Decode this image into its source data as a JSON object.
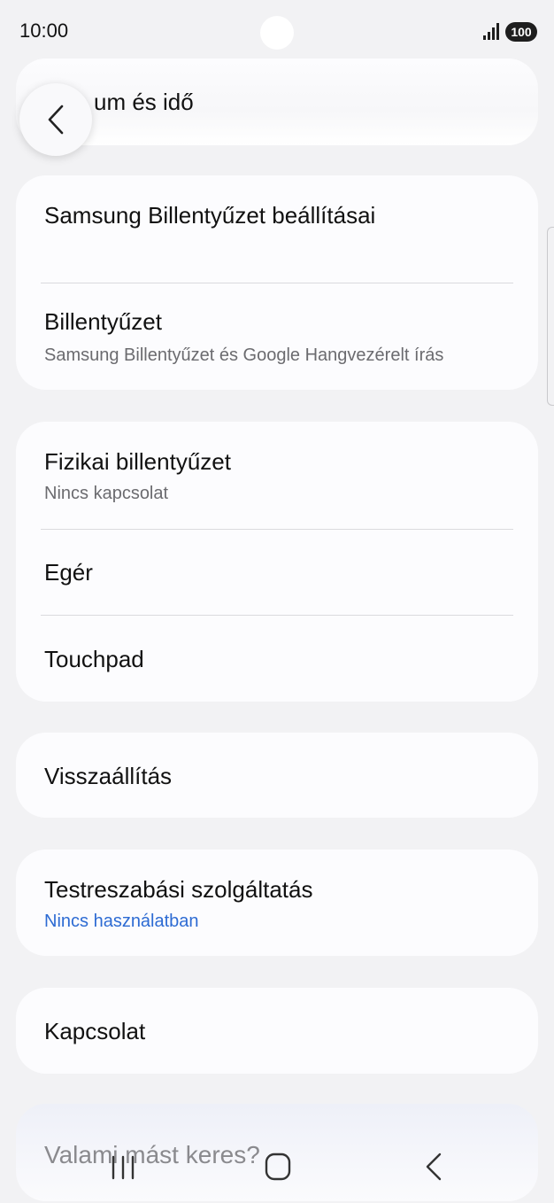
{
  "status_bar": {
    "time": "10:00",
    "battery": "100"
  },
  "header": {
    "partial_title": "um és idő"
  },
  "group1": {
    "samsung_keyboard": {
      "title": "Samsung Billentyűzet beállításai"
    },
    "keyboard": {
      "title": "Billentyűzet",
      "subtitle": "Samsung Billentyűzet és Google Hangvezérelt írás"
    }
  },
  "group2": {
    "physical_keyboard": {
      "title": "Fizikai billentyűzet",
      "subtitle": "Nincs kapcsolat"
    },
    "mouse": {
      "title": "Egér"
    },
    "touchpad": {
      "title": "Touchpad"
    }
  },
  "reset": {
    "title": "Visszaállítás"
  },
  "customization": {
    "title": "Testreszabási szolgáltatás",
    "subtitle": "Nincs használatban"
  },
  "connection": {
    "title": "Kapcsolat"
  },
  "search_prompt": {
    "text": "Valami mást keres?"
  },
  "colors": {
    "link": "#2d6bd3",
    "background": "#f2f2f4",
    "card": "#fcfcfe"
  }
}
